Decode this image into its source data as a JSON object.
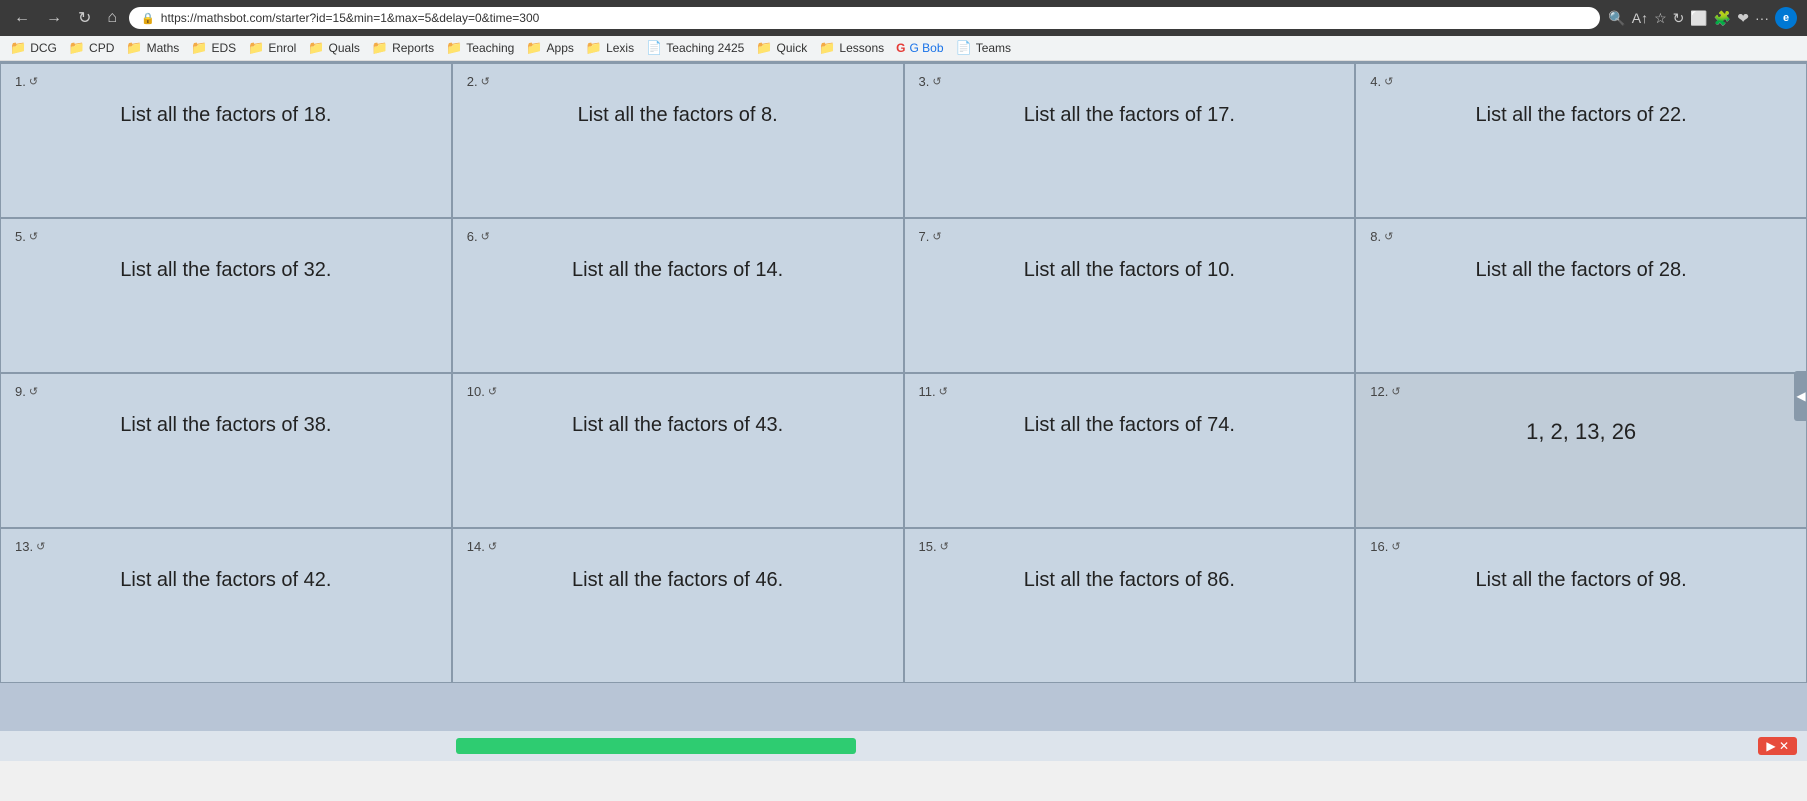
{
  "browser": {
    "url": "https://mathsbot.com/starter?id=15&min=1&max=5&delay=0&time=300",
    "back_label": "←",
    "forward_label": "→",
    "refresh_label": "↻",
    "home_label": "⌂",
    "edge_label": "e"
  },
  "bookmarks": [
    {
      "id": "dcg",
      "label": "DCG",
      "icon": "📁"
    },
    {
      "id": "cpd",
      "label": "CPD",
      "icon": "📁"
    },
    {
      "id": "maths",
      "label": "Maths",
      "icon": "📁"
    },
    {
      "id": "eds",
      "label": "EDS",
      "icon": "📁"
    },
    {
      "id": "enrol",
      "label": "Enrol",
      "icon": "📁"
    },
    {
      "id": "quals",
      "label": "Quals",
      "icon": "📁"
    },
    {
      "id": "reports",
      "label": "Reports",
      "icon": "📁"
    },
    {
      "id": "teaching",
      "label": "Teaching",
      "icon": "📁"
    },
    {
      "id": "apps",
      "label": "Apps",
      "icon": "📁"
    },
    {
      "id": "lexis",
      "label": "Lexis",
      "icon": "📁"
    },
    {
      "id": "teaching2425",
      "label": "Teaching 2425",
      "icon": "📄"
    },
    {
      "id": "quick",
      "label": "Quick",
      "icon": "📁"
    },
    {
      "id": "lessons",
      "label": "Lessons",
      "icon": "📁"
    },
    {
      "id": "gbob",
      "label": "G Bob",
      "icon": "G"
    },
    {
      "id": "teams",
      "label": "Teams",
      "icon": "📄"
    }
  ],
  "questions": [
    {
      "number": "1",
      "text": "List all the factors of 18.",
      "answer": ""
    },
    {
      "number": "2",
      "text": "List all the factors of 8.",
      "answer": ""
    },
    {
      "number": "3",
      "text": "List all the factors of 17.",
      "answer": ""
    },
    {
      "number": "4",
      "text": "List all the factors of 22.",
      "answer": ""
    },
    {
      "number": "5",
      "text": "List all the factors of 32.",
      "answer": ""
    },
    {
      "number": "6",
      "text": "List all the factors of 14.",
      "answer": ""
    },
    {
      "number": "7",
      "text": "List all the factors of 10.",
      "answer": ""
    },
    {
      "number": "8",
      "text": "List all the factors of 28.",
      "answer": ""
    },
    {
      "number": "9",
      "text": "List all the factors of 38.",
      "answer": ""
    },
    {
      "number": "10",
      "text": "List all the factors of 43.",
      "answer": ""
    },
    {
      "number": "11",
      "text": "List all the factors of 74.",
      "answer": ""
    },
    {
      "number": "12",
      "text": "",
      "answer": "1, 2, 13, 26"
    },
    {
      "number": "13",
      "text": "List all the factors of 42.",
      "answer": ""
    },
    {
      "number": "14",
      "text": "List all the factors of 46.",
      "answer": ""
    },
    {
      "number": "15",
      "text": "List all the factors of 86.",
      "answer": ""
    },
    {
      "number": "16",
      "text": "List all the factors of 98.",
      "answer": ""
    }
  ],
  "controls": {
    "zoom_in": "+",
    "zoom_out": "−",
    "expand": "⤢",
    "close": "✕",
    "right_arrow": "◀"
  }
}
